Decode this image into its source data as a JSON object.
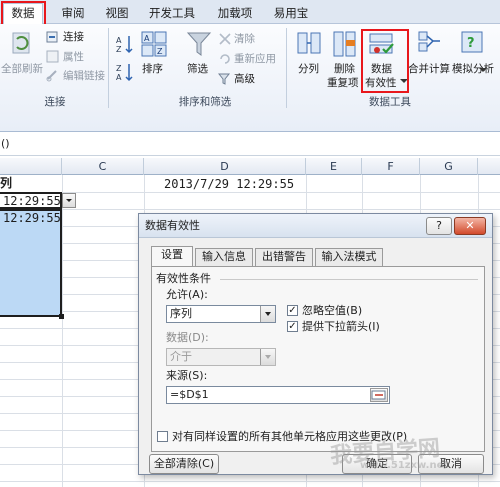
{
  "ribbon_tabs": [
    {
      "label": "数据",
      "active": true
    },
    {
      "label": "审阅"
    },
    {
      "label": "视图"
    },
    {
      "label": "开发工具"
    },
    {
      "label": "加载项"
    },
    {
      "label": "易用宝"
    }
  ],
  "connections_group": {
    "refresh_all": "全部刷新",
    "connections": "连接",
    "properties": "属性",
    "edit_links": "编辑链接",
    "group_label": "连接"
  },
  "sort_filter_group": {
    "sort": "排序",
    "filter": "筛选",
    "clear": "清除",
    "reapply": "重新应用",
    "advanced": "高级",
    "group_label": "排序和筛选"
  },
  "data_tools_group": {
    "text_to_columns": "分列",
    "remove_duplicates_line1": "删除",
    "remove_duplicates_line2": "重复项",
    "data_validation_line1": "数据",
    "data_validation_line2": "有效性",
    "consolidate": "合并计算",
    "what_if": "模拟分析",
    "group_label": "数据工具"
  },
  "formula_bar": {
    "value": "()"
  },
  "sheet": {
    "columns": [
      "C",
      "D",
      "E",
      "F",
      "G"
    ],
    "col_b_partial": "列",
    "cell_b_row1": "12:29:55",
    "cell_b_row2": "12:29:55",
    "cell_d1": "2013/7/29 12:29:55"
  },
  "dialog": {
    "title": "数据有效性",
    "help_label": "?",
    "tabs": [
      "设置",
      "输入信息",
      "出错警告",
      "输入法模式"
    ],
    "section_label": "有效性条件",
    "allow_label": "允许(A):",
    "allow_value": "序列",
    "ignore_blank_label": "忽略空值(B)",
    "ignore_blank_checked": true,
    "in_cell_dropdown_label": "提供下拉箭头(I)",
    "in_cell_dropdown_checked": true,
    "data_label": "数据(D):",
    "data_value": "介于",
    "source_label": "来源(S):",
    "source_value": "=$D$1",
    "apply_all_label": "对有同样设置的所有其他单元格应用这些更改(P)",
    "apply_all_checked": false,
    "clear_all_button": "全部清除(C)",
    "ok_button": "确定",
    "cancel_button": "取消"
  },
  "watermark": {
    "line1": "我要自学网",
    "line2": "www.51zxw.net"
  },
  "colors": {
    "highlight_red": "#e8171c",
    "selection_blue": "#bcd9f5",
    "ribbon_bg": "#e8eef7"
  }
}
